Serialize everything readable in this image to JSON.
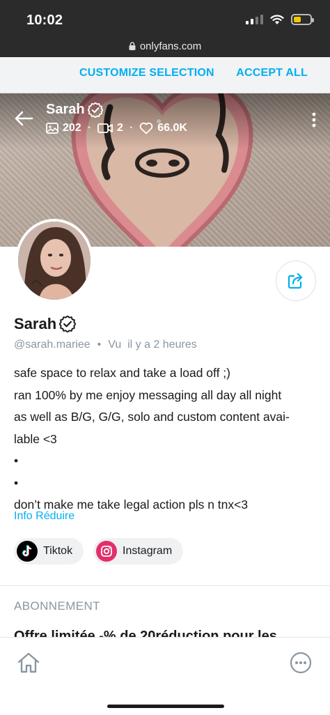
{
  "status_bar": {
    "time": "10:02"
  },
  "browser": {
    "url": "onlyfans.com"
  },
  "cookie_banner": {
    "customize": "CUSTOMIZE SELECTION",
    "accept": "ACCEPT ALL"
  },
  "cover": {
    "name": "Sarah",
    "photos": "202",
    "videos": "2",
    "likes": "66.0K"
  },
  "profile": {
    "name": "Sarah",
    "username": "@sarah.mariee",
    "last_seen": "Vu  il y a 2 heures",
    "bio": [
      "safe space to relax and take a load off ;)",
      "ran 100% by me enjoy messaging all day all night",
      "as well as B/G, G/G, solo and custom content avai-",
      "lable <3",
      "•",
      "•",
      "don’t make me take legal action pls n tnx<3"
    ],
    "info_link": "Info Réduire"
  },
  "socials": [
    {
      "label": "Tiktok",
      "icon": "tiktok-icon"
    },
    {
      "label": "Instagram",
      "icon": "instagram-icon"
    }
  ],
  "subscription": {
    "title": "ABONNEMENT",
    "offer": "Offre limitée -% de 20réduction pour les"
  },
  "colors": {
    "accent": "#00aff0",
    "muted": "#8a96a3",
    "instagram": "#e1306c"
  },
  "icons": [
    "back-arrow-icon",
    "verified-icon",
    "image-icon",
    "video-icon",
    "heart-icon",
    "more-vertical-icon",
    "share-icon",
    "home-icon",
    "more-horizontal-icon",
    "lock-icon"
  ]
}
